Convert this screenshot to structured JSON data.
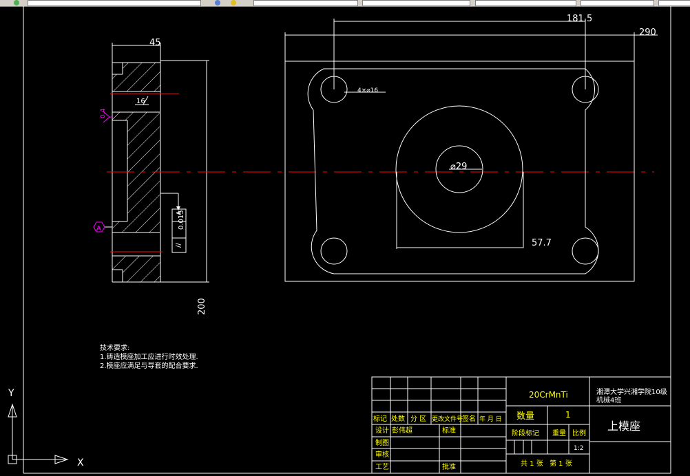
{
  "app": {
    "colors": {
      "bg": "#000000",
      "lines": "#ffffff",
      "yellow": "#ffff00",
      "center": "#ff0000",
      "magenta": "#ff00ff",
      "toolbar": "#d4d0c8"
    }
  },
  "toolbar": {
    "icons": [
      "layer-icon",
      "color-icon"
    ],
    "fields": [
      "",
      "",
      "",
      "",
      "",
      ""
    ]
  },
  "drawing": {
    "dims": {
      "thickness": "45",
      "height": "200",
      "chamfer": "16",
      "roughness": "0.4",
      "span": "181.5",
      "overall": "290",
      "holes": "4×⌀16",
      "bore": "⌀29",
      "boss": "57.7"
    },
    "datum": "A",
    "tolerance": {
      "symbol": "//",
      "value": "0.015",
      "datum": "A"
    },
    "notes": {
      "title": "技术要求:",
      "items": [
        "1.铸造模座加工应进行时效处理.",
        "2.模座应满足与导套的配合要求."
      ]
    }
  },
  "title_block": {
    "material": "20CrMnTi",
    "school": "湘潭大学兴湘学院10级",
    "class": "机械4班",
    "part_name": "上模座",
    "qty_label": "数量",
    "qty_value": "1",
    "headers": [
      "标记",
      "处数",
      "分 区",
      "更改文件号",
      "签名",
      "年 月 日"
    ],
    "design": "设计",
    "designer": "彭伟超",
    "standardize": "标准",
    "draw": "制图",
    "review": "审核",
    "process": "工艺",
    "approve": "批准",
    "stage_mark": "阶段标记",
    "weight": "重量",
    "scale_label": "比例",
    "scale_value": "1:2",
    "sheets_total": "共 1 张",
    "sheet_no": "第 1 张"
  },
  "ucs": {
    "x": "X",
    "y": "Y"
  }
}
